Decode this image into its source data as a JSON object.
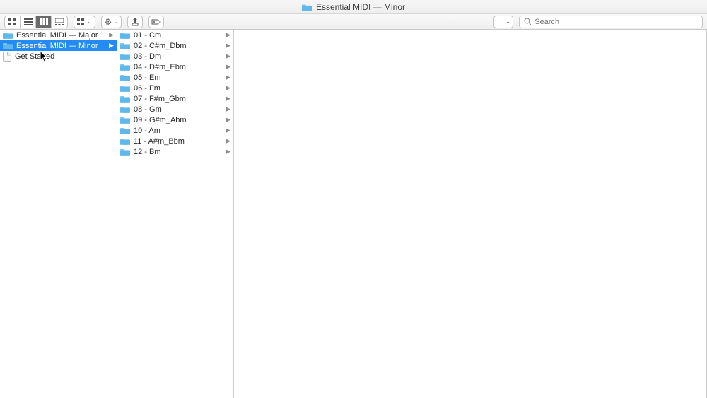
{
  "title": "Essential MIDI — Minor",
  "search": {
    "placeholder": "Search"
  },
  "col1": {
    "items": [
      {
        "label": "Essential MIDI — Major",
        "kind": "folder",
        "selected": false,
        "hasChildren": true
      },
      {
        "label": "Essential MIDI — Minor",
        "kind": "folder",
        "selected": true,
        "hasChildren": true
      },
      {
        "label": "Get Started",
        "kind": "document",
        "selected": false,
        "hasChildren": false
      }
    ]
  },
  "col2": {
    "items": [
      {
        "label": "01 - Cm",
        "kind": "folder",
        "hasChildren": true
      },
      {
        "label": "02 - C#m_Dbm",
        "kind": "folder",
        "hasChildren": true
      },
      {
        "label": "03 - Dm",
        "kind": "folder",
        "hasChildren": true
      },
      {
        "label": "04 - D#m_Ebm",
        "kind": "folder",
        "hasChildren": true
      },
      {
        "label": "05 - Em",
        "kind": "folder",
        "hasChildren": true
      },
      {
        "label": "06 - Fm",
        "kind": "folder",
        "hasChildren": true
      },
      {
        "label": "07 - F#m_Gbm",
        "kind": "folder",
        "hasChildren": true
      },
      {
        "label": "08 - Gm",
        "kind": "folder",
        "hasChildren": true
      },
      {
        "label": "09 - G#m_Abm",
        "kind": "folder",
        "hasChildren": true
      },
      {
        "label": "10 - Am",
        "kind": "folder",
        "hasChildren": true
      },
      {
        "label": "11 - A#m_Bbm",
        "kind": "folder",
        "hasChildren": true
      },
      {
        "label": "12 - Bm",
        "kind": "folder",
        "hasChildren": true
      }
    ]
  }
}
